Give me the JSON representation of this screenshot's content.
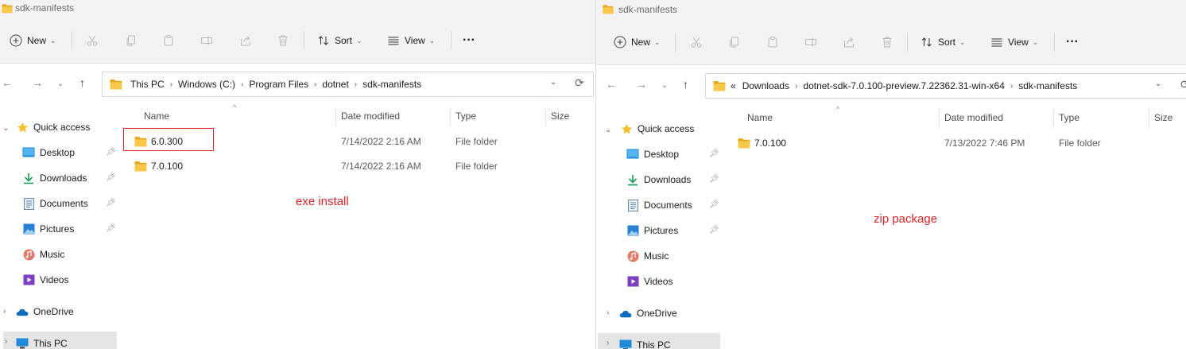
{
  "left": {
    "title": "sdk-manifests",
    "toolbar": {
      "new_label": "New",
      "sort_label": "Sort",
      "view_label": "View",
      "more_label": "···"
    },
    "breadcrumbs": [
      "This PC",
      "Windows (C:)",
      "Program Files",
      "dotnet",
      "sdk-manifests"
    ],
    "nav": {
      "quick_access": "Quick access",
      "items": [
        {
          "label": "Desktop",
          "icon": "desktop-icon",
          "pinned": true
        },
        {
          "label": "Downloads",
          "icon": "download-icon",
          "pinned": true
        },
        {
          "label": "Documents",
          "icon": "documents-icon",
          "pinned": true
        },
        {
          "label": "Pictures",
          "icon": "pictures-icon",
          "pinned": true
        },
        {
          "label": "Music",
          "icon": "music-icon",
          "pinned": false
        },
        {
          "label": "Videos",
          "icon": "videos-icon",
          "pinned": false
        }
      ],
      "onedrive": "OneDrive",
      "this_pc": "This PC"
    },
    "columns": {
      "name": "Name",
      "date": "Date modified",
      "type": "Type",
      "size": "Size"
    },
    "rows": [
      {
        "name": "6.0.300",
        "date": "7/14/2022 2:16 AM",
        "type": "File folder"
      },
      {
        "name": "7.0.100",
        "date": "7/14/2022 2:16 AM",
        "type": "File folder"
      }
    ],
    "annotation": "exe install"
  },
  "right": {
    "title": "sdk-manifests",
    "toolbar": {
      "new_label": "New",
      "sort_label": "Sort",
      "view_label": "View",
      "more_label": "···"
    },
    "breadcrumb_overflow": "«",
    "breadcrumbs": [
      "Downloads",
      "dotnet-sdk-7.0.100-preview.7.22362.31-win-x64",
      "sdk-manifests"
    ],
    "nav": {
      "quick_access": "Quick access",
      "items": [
        {
          "label": "Desktop",
          "icon": "desktop-icon",
          "pinned": true
        },
        {
          "label": "Downloads",
          "icon": "download-icon",
          "pinned": true
        },
        {
          "label": "Documents",
          "icon": "documents-icon",
          "pinned": true
        },
        {
          "label": "Pictures",
          "icon": "pictures-icon",
          "pinned": true
        },
        {
          "label": "Music",
          "icon": "music-icon",
          "pinned": false
        },
        {
          "label": "Videos",
          "icon": "videos-icon",
          "pinned": false
        }
      ],
      "onedrive": "OneDrive",
      "this_pc": "This PC"
    },
    "columns": {
      "name": "Name",
      "date": "Date modified",
      "type": "Type",
      "size": "Size"
    },
    "rows": [
      {
        "name": "7.0.100",
        "date": "7/13/2022 7:46 PM",
        "type": "File folder"
      }
    ],
    "annotation": "zip package"
  },
  "colors": {
    "folder": "#f8c84a",
    "folder_dark": "#e6a91e",
    "highlight": "#d6262c",
    "accent": "#0067c0"
  }
}
